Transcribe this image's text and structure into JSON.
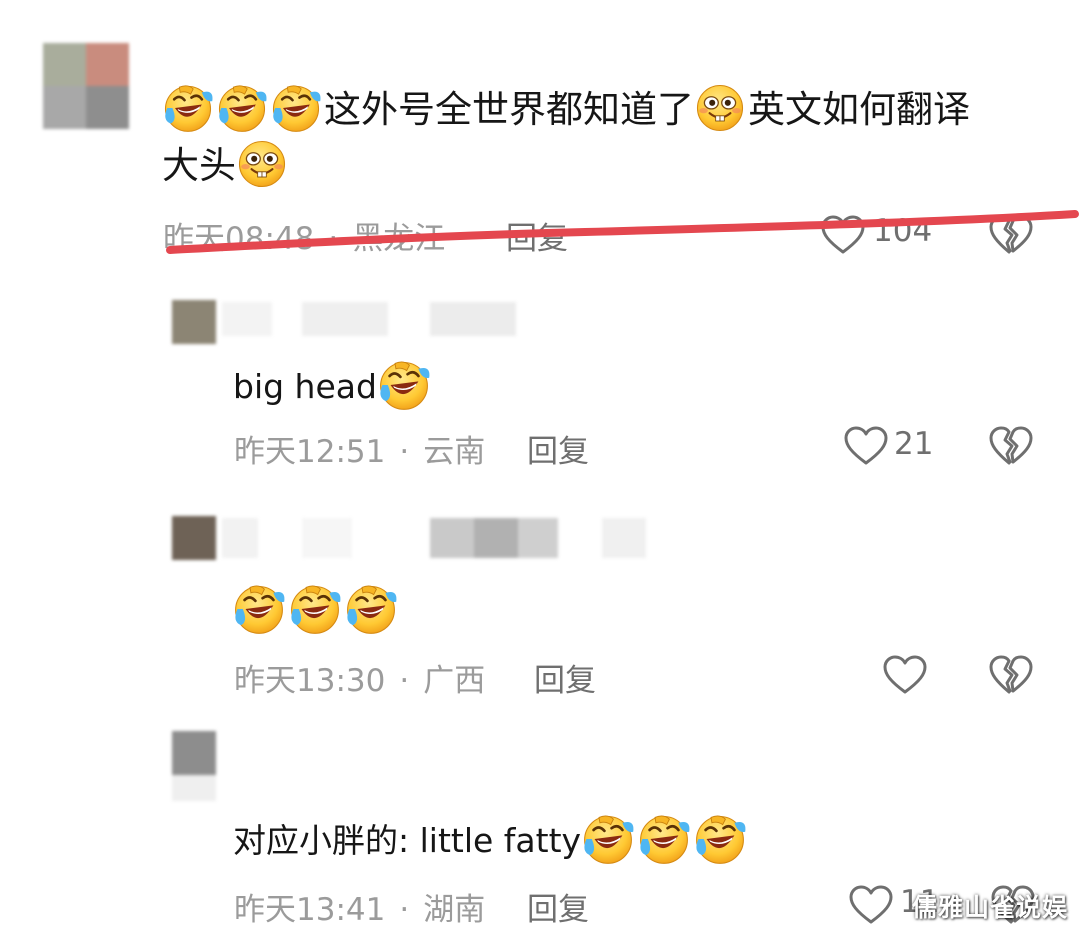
{
  "main_comment": {
    "text_part1": "这外号全世界都知道了",
    "text_part2": "英文如何翻译",
    "text_part3": "大头",
    "emojis": [
      "laugh-cry-icon",
      "grin-teeth-icon"
    ],
    "time": "昨天08:48",
    "location": "黑龙江",
    "reply_label": "回复",
    "likes": "104"
  },
  "replies": [
    {
      "text": "big head",
      "time": "昨天12:51",
      "location": "云南",
      "reply_label": "回复",
      "likes": "21"
    },
    {
      "text": "",
      "time": "昨天13:30",
      "location": "广西",
      "reply_label": "回复",
      "likes": ""
    },
    {
      "text": "对应小胖的: little fatty",
      "time": "昨天13:41",
      "location": "湖南",
      "reply_label": "回复",
      "likes": "11"
    }
  ],
  "annotation": {
    "strike_color": "#e4474f"
  },
  "watermark": "儒雅山雀说娱",
  "colors": {
    "meta_gray": "#9b9b9b",
    "icon_gray": "#6f6f6f",
    "text_dark": "#161616"
  }
}
